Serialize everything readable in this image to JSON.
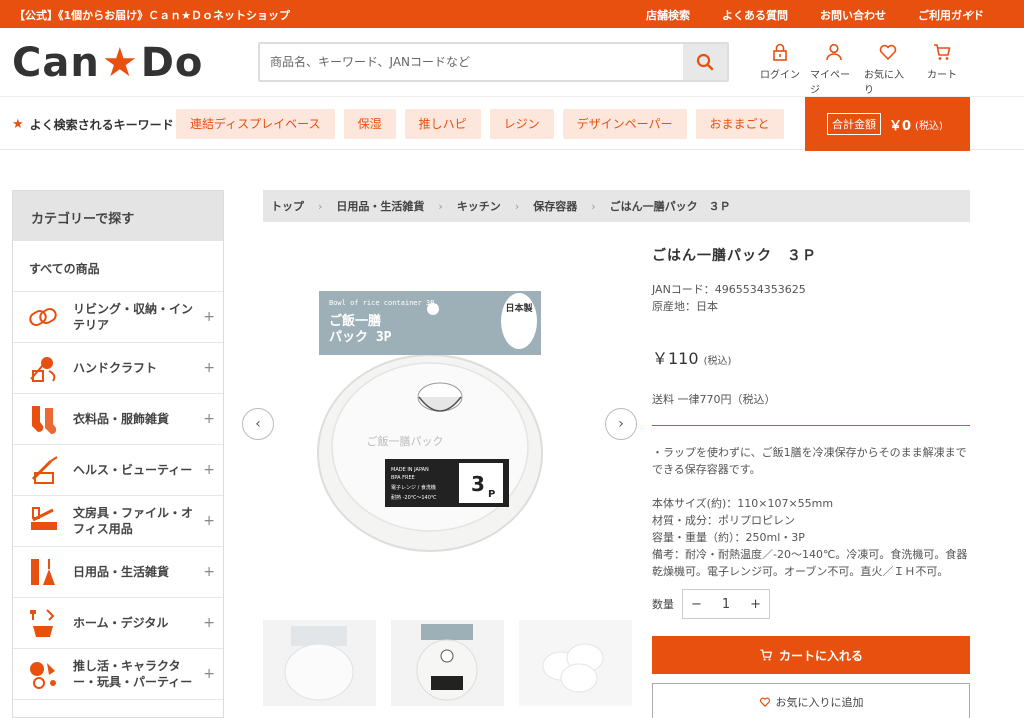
{
  "topbar": {
    "tagline": "【公式】《1個からお届け》Ｃａｎ★Ｄｏネットショップ",
    "links": [
      "店舗検索",
      "よくある質問",
      "お問い合わせ",
      "ご利用ガイド"
    ]
  },
  "header": {
    "logo_left": "Can",
    "logo_right": "Do",
    "search_placeholder": "商品名、キーワード、JANコードなど",
    "icons": [
      {
        "label": "ログイン",
        "icon": "lock-icon"
      },
      {
        "label": "マイページ",
        "icon": "user-icon"
      },
      {
        "label": "お気に入り",
        "icon": "heart-icon"
      },
      {
        "label": "カート",
        "icon": "cart-icon"
      }
    ]
  },
  "keywords": {
    "label": "よく検索されるキーワード",
    "chips": [
      "連結ディスプレイベース",
      "保湿",
      "推しハピ",
      "レジン",
      "デザインペーパー",
      "おままごと"
    ]
  },
  "cart_total": {
    "label": "合計金額",
    "value": "￥0",
    "tax": "(税込)"
  },
  "sidebar": {
    "heading": "カテゴリーで探す",
    "all": "すべての商品",
    "items": [
      {
        "label": "リビング・収納・インテリア",
        "icon": "living-icon"
      },
      {
        "label": "ハンドクラフト",
        "icon": "handcraft-icon"
      },
      {
        "label": "衣料品・服飾雑貨",
        "icon": "socks-icon"
      },
      {
        "label": "ヘルス・ビューティー",
        "icon": "beauty-icon"
      },
      {
        "label": "文房具・ファイル・オフィス用品",
        "icon": "stationery-icon"
      },
      {
        "label": "日用品・生活雑貨",
        "icon": "daily-goods-icon"
      },
      {
        "label": "ホーム・デジタル",
        "icon": "home-digital-icon"
      },
      {
        "label": "推し活・キャラクター・玩具・パーティー",
        "icon": "party-icon"
      }
    ]
  },
  "breadcrumb": [
    "トップ",
    "日用品・生活雑貨",
    "キッチン",
    "保存容器",
    "ごはん一膳パック　３Ｐ"
  ],
  "product": {
    "title": "ごはん一膳パック　３Ｐ",
    "jan": "JANコード：4965534353625",
    "origin": "原産地：日本",
    "price": "￥110",
    "price_tax": "(税込)",
    "shipping": "送料 一律770円（税込）",
    "desc1": "・ラップを使わずに、ご飯1膳を冷凍保存からそのまま解凍までできる保存容器です。",
    "spec_size": "本体サイズ(約)：110×107×55mm",
    "spec_material": "材質・成分：ポリプロピレン",
    "spec_capacity": "容量・重量（約）：250ml・3P",
    "spec_note": "備考：耐冷・耐熱温度／-20〜140℃。冷凍可。食洗機可。食器乾燥機可。電子レンジ可。オーブン不可。直火／ＩＨ不可。",
    "package_label_en": "Bowl of rice container 3P",
    "package_title_1": "ご飯一膳",
    "package_title_2": "パック 3P",
    "package_badge": "日本製",
    "package_tray_text": "ご飯一膳パック",
    "package_count": "3",
    "package_count_unit": "P"
  },
  "purchase": {
    "qty_label": "数量",
    "qty_value": "1",
    "minus": "−",
    "plus": "+",
    "cart_button": "カートに入れる",
    "fav_button": "お気に入りに追加"
  },
  "colors": {
    "brand": "#e8500f",
    "chip_bg": "#fde6dc"
  }
}
